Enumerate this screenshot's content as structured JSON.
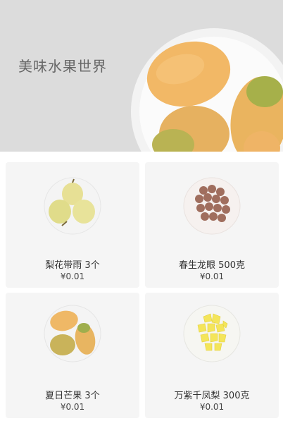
{
  "banner": {
    "title": "美味水果世界",
    "image_icon": "mango-plate-image"
  },
  "products": [
    {
      "name": "梨花带雨 3个",
      "price": "¥0.01",
      "icon": "pear-plate-image"
    },
    {
      "name": "春生龙眼 500克",
      "price": "¥0.01",
      "icon": "longan-plate-image"
    },
    {
      "name": "夏日芒果 3个",
      "price": "¥0.01",
      "icon": "mango-plate-image"
    },
    {
      "name": "万紫千凤梨 300克",
      "price": "¥0.01",
      "icon": "pineapple-plate-image"
    }
  ],
  "colors": {
    "banner_bg": "#dcdcdc",
    "card_bg": "#f5f5f5"
  }
}
